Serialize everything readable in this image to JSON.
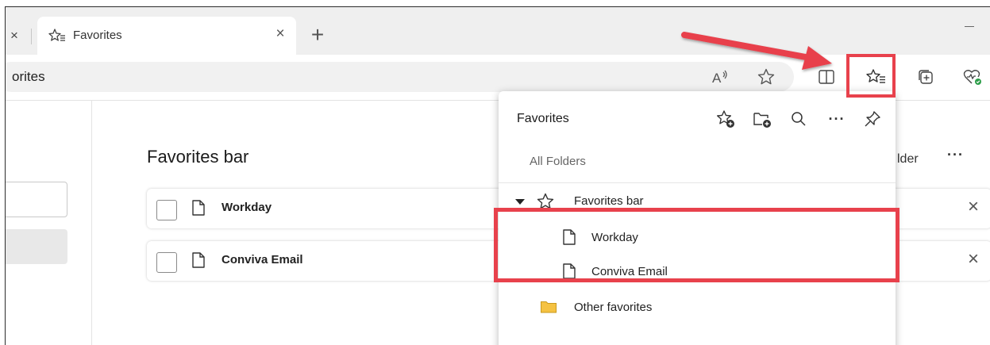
{
  "tab": {
    "prev_close": "×",
    "title": "Favorites",
    "close": "×",
    "new_tab": "+"
  },
  "address": {
    "text": "orites"
  },
  "page": {
    "title": "Favorites bar",
    "add_folder_fragment": "lder",
    "more": "···",
    "items": [
      {
        "label": "Workday",
        "delete": "×"
      },
      {
        "label": "Conviva Email",
        "delete": "×"
      }
    ]
  },
  "flyout": {
    "title": "Favorites",
    "more": "···",
    "breadcrumb": "All Folders",
    "tree": {
      "favorites_bar": "Favorites bar",
      "children": [
        "Workday",
        "Conviva Email"
      ],
      "other": "Other favorites"
    }
  },
  "colors": {
    "highlight": "#e8414c",
    "folder": "#f5c242"
  }
}
